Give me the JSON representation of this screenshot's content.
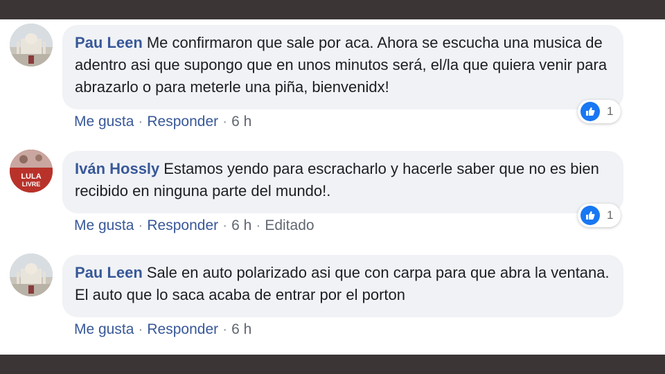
{
  "comments": [
    {
      "author": "Pau Leen",
      "text": "Me confirmaron que sale por aca. Ahora se escucha una musica de adentro asi que supongo que en unos minutos será, el/la que quiera venir para abrazarlo o para meterle una piña, bienvenidx!",
      "like_label": "Me gusta",
      "reply_label": "Responder",
      "time": "6 h",
      "reaction_count": "1",
      "reaction_icon": "like-icon"
    },
    {
      "author": "Iván Hossly",
      "text": "Estamos yendo para escracharlo y hacerle saber que no es bien recibido en ninguna parte del mundo!.",
      "like_label": "Me gusta",
      "reply_label": "Responder",
      "time": "6 h",
      "edited_label": "Editado",
      "reaction_count": "1",
      "reaction_icon": "like-icon",
      "avatar_text": [
        "LULA",
        "LIVRE"
      ]
    },
    {
      "author": "Pau Leen",
      "text": "Sale en auto polarizado asi que con carpa para que abra la ventana. El auto que lo saca acaba de entrar por el porton",
      "like_label": "Me gusta",
      "reply_label": "Responder",
      "time": "6 h"
    }
  ],
  "separator": "·",
  "colors": {
    "link": "#385898",
    "like_blue": "#1877f2",
    "bubble": "#f0f2f5",
    "frame": "#3b3536"
  }
}
